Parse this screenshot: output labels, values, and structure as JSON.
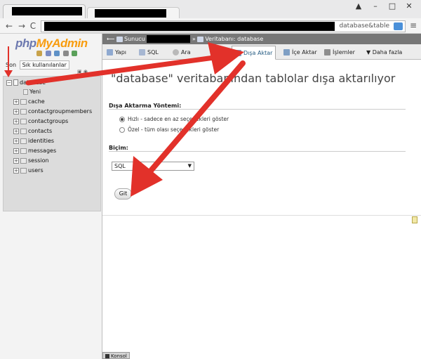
{
  "browser": {
    "url_tail": "database&table"
  },
  "sidebar": {
    "logo_php": "php",
    "logo_myadmin": "MyAdmin",
    "recent_label": "Son",
    "favorites_label": "Sık kullanılanlar",
    "tree": {
      "database": "database",
      "new": "Yeni",
      "tables": [
        "cache",
        "contactgroupmembers",
        "contactgroups",
        "contacts",
        "identities",
        "messages",
        "session",
        "users"
      ]
    }
  },
  "main": {
    "breadcrumb": {
      "server": "Sunucu",
      "db_prefix": "Veritabanı:",
      "db_name": "database"
    },
    "tabs": [
      {
        "label": "Yapı"
      },
      {
        "label": "SQL"
      },
      {
        "label": "Ara"
      },
      {
        "label": "Dışa Aktar"
      },
      {
        "label": "İçe Aktar"
      },
      {
        "label": "İşlemler"
      },
      {
        "label": "Daha fazla"
      }
    ],
    "title": "\"database\" veritabanından tablolar dışa aktarılıyor",
    "method_label": "Dışa Aktarma Yöntemi:",
    "method_quick": "Hızlı - sadece en az seçenekleri göster",
    "method_custom": "Özel - tüm olası seçenekleri göster",
    "format_label": "Biçim:",
    "format_value": "SQL",
    "go_label": "Git",
    "console_label": "Konsol"
  },
  "colors": {
    "arrow": "#e2312a",
    "logo_php": "#6c78af",
    "logo_myadmin": "#f89c0e",
    "breadcrumb_bg": "#777777"
  },
  "icons": [
    "back-icon",
    "forward-icon",
    "reload-icon",
    "menu-icon",
    "home-icon",
    "database-icon",
    "table-icon",
    "export-icon",
    "import-icon",
    "wrench-icon"
  ]
}
